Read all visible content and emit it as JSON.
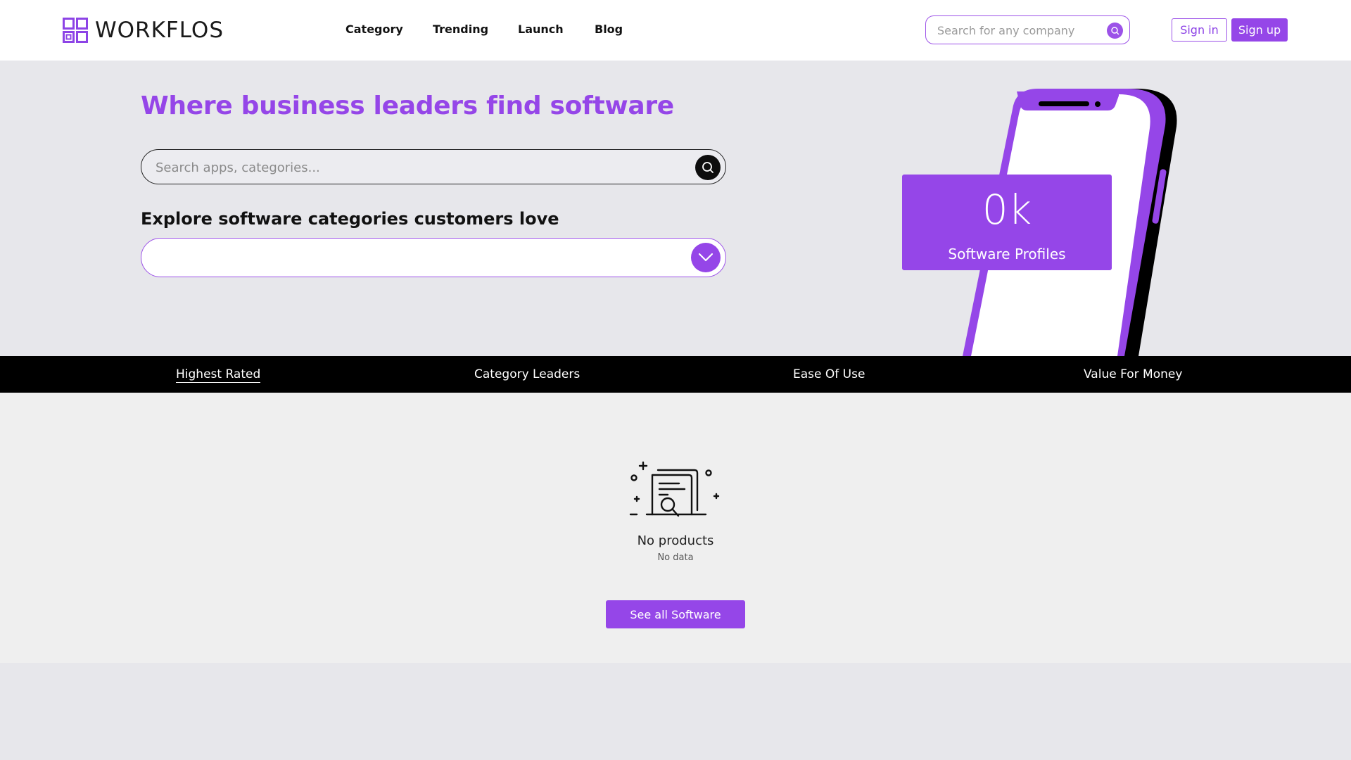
{
  "header": {
    "logo_text": "WORKFLOS",
    "nav": [
      "Category",
      "Trending",
      "Launch",
      "Blog"
    ],
    "search_placeholder": "Search for any company",
    "signin_label": "Sign in",
    "signup_label": "Sign up"
  },
  "hero": {
    "title": "Where business leaders find software",
    "search_placeholder": "Search apps, categories...",
    "explore_title": "Explore software categories customers love",
    "category_value": "",
    "stat_value": "0k",
    "stat_label": "Software Profiles"
  },
  "tabs": [
    {
      "label": "Highest Rated",
      "active": true
    },
    {
      "label": "Category Leaders",
      "active": false
    },
    {
      "label": "Ease Of Use",
      "active": false
    },
    {
      "label": "Value For Money",
      "active": false
    }
  ],
  "content": {
    "empty_title": "No products",
    "empty_subtitle": "No data",
    "see_all_label": "See all Software"
  },
  "colors": {
    "accent": "#9546e8",
    "tabbar": "#000000",
    "background": "#e7e7eb"
  },
  "icons": [
    "logo-icon",
    "search-icon",
    "chevron-down-icon",
    "empty-documents-icon",
    "phone-illustration"
  ]
}
